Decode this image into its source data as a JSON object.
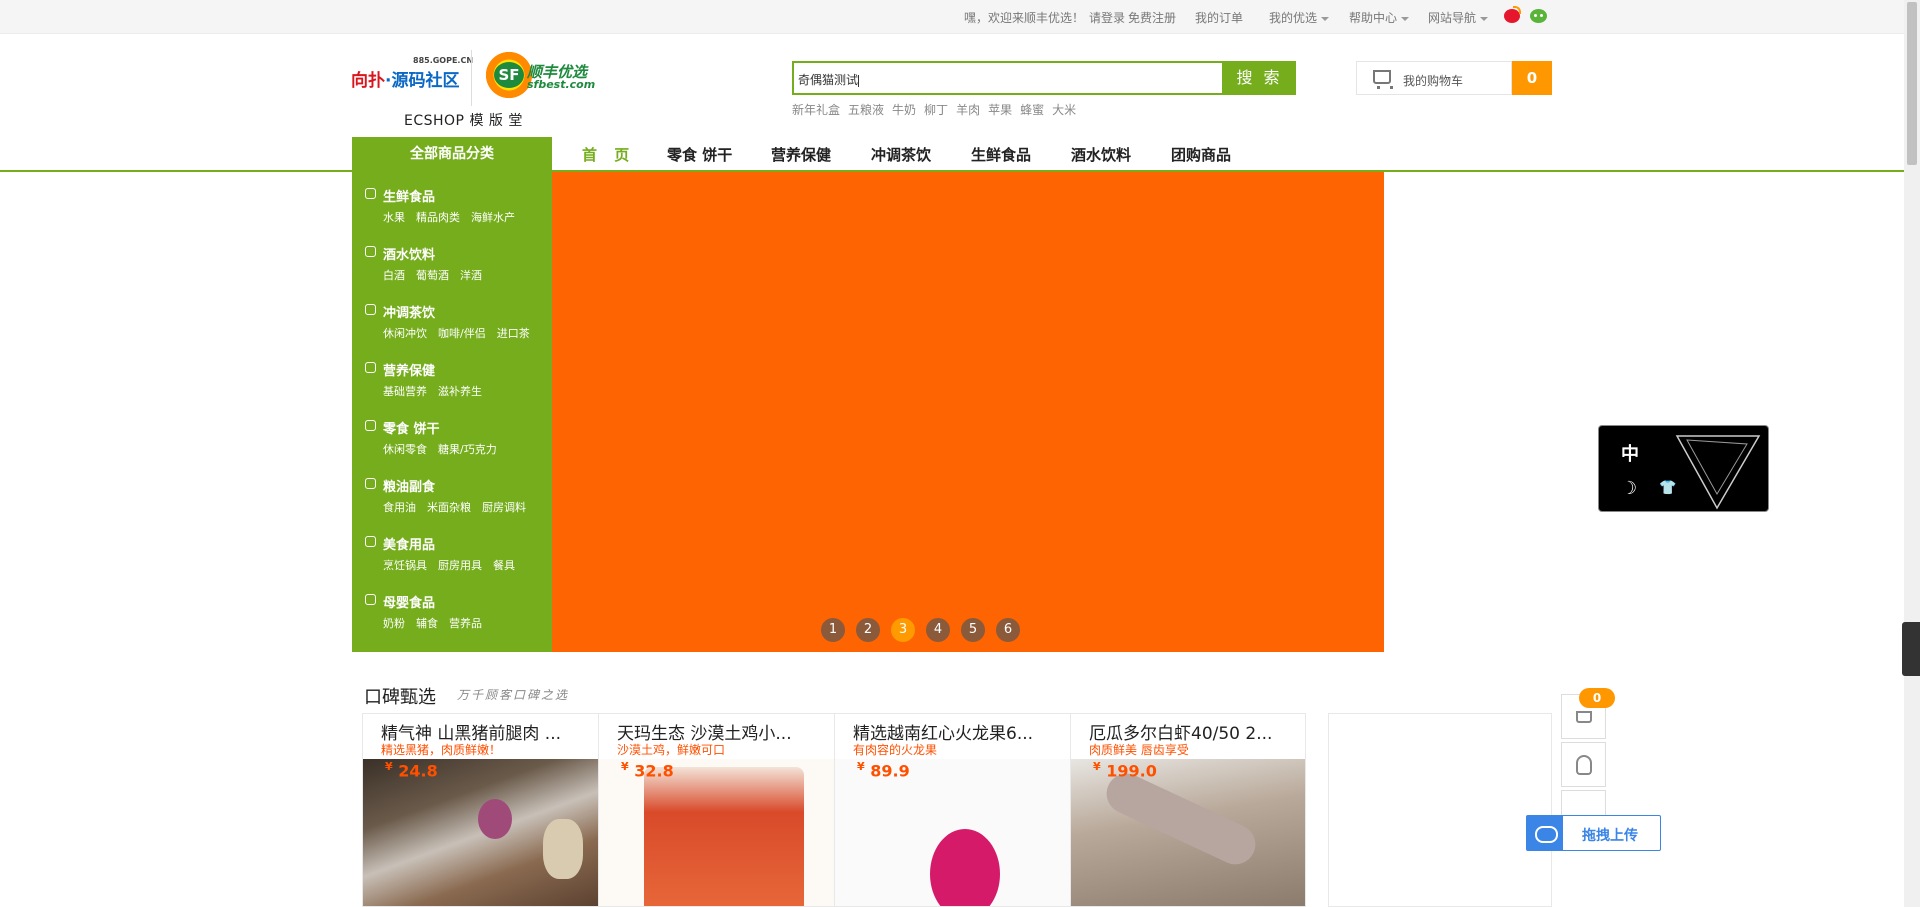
{
  "topbar": {
    "welcome": "嘿，欢迎来顺丰优选！",
    "login": "请登录",
    "register": "免费注册",
    "my_orders": "我的订单",
    "my_sf": "我的优选",
    "help": "帮助中心",
    "site_nav": "网站导航"
  },
  "logo": {
    "left_red": "向扑",
    "left_blue": "·源码社区",
    "site": "885.GOPE.CN",
    "sf_mark": "SF",
    "sf_name": "顺丰优选",
    "sf_url": "sfbest.com",
    "tagline": "ECSHOP 模 版 堂"
  },
  "search": {
    "value": "奇偶猫测试",
    "button": "搜 索",
    "hot_words": [
      "新年礼盒",
      "五粮液",
      "牛奶",
      "柳丁",
      "羊肉",
      "苹果",
      "蜂蜜",
      "大米"
    ]
  },
  "cart": {
    "label": "我的购物车",
    "count": "0"
  },
  "nav": {
    "all_categories": "全部商品分类",
    "items": [
      "首 页",
      "零食 饼干",
      "营养保健",
      "冲调茶饮",
      "生鲜食品",
      "酒水饮料",
      "团购商品"
    ]
  },
  "categories": [
    {
      "title": "生鲜食品",
      "subs": [
        "水果",
        "精品肉类",
        "海鲜水产"
      ]
    },
    {
      "title": "酒水饮料",
      "subs": [
        "白酒",
        "葡萄酒",
        "洋酒"
      ]
    },
    {
      "title": "冲调茶饮",
      "subs": [
        "休闲冲饮",
        "咖啡/伴侣",
        "进口茶"
      ]
    },
    {
      "title": "营养保健",
      "subs": [
        "基础营养",
        "滋补养生"
      ]
    },
    {
      "title": "零食 饼干",
      "subs": [
        "休闲零食",
        "糖果/巧克力"
      ]
    },
    {
      "title": "粮油副食",
      "subs": [
        "食用油",
        "米面杂粮",
        "厨房调料"
      ]
    },
    {
      "title": "美食用品",
      "subs": [
        "烹饪锅具",
        "厨房用具",
        "餐具"
      ]
    },
    {
      "title": "母婴食品",
      "subs": [
        "奶粉",
        "辅食",
        "营养品"
      ]
    }
  ],
  "banner": {
    "color": "#ff6402",
    "pages": [
      "1",
      "2",
      "3",
      "4",
      "5",
      "6"
    ],
    "active_page": "3"
  },
  "float_widget": {
    "zh": "中"
  },
  "section": {
    "title": "口碑甄选",
    "subtitle": "万千顾客口碑之选"
  },
  "products": [
    {
      "name": "精气神 山黑猪前腿肉 ...",
      "desc": "精选黑猪，肉质鲜嫩！",
      "currency": "¥",
      "price": "24.8",
      "image": "pork-photo"
    },
    {
      "name": "天玛生态 沙漠土鸡小...",
      "desc": "沙漠土鸡，鲜嫩可口",
      "currency": "¥",
      "price": "32.8",
      "image": "chicken-package"
    },
    {
      "name": "精选越南红心火龙果6...",
      "desc": "有肉容的火龙果",
      "currency": "¥",
      "price": "89.9",
      "image": "dragonfruit-photo"
    },
    {
      "name": "厄瓜多尔白虾40/50 2...",
      "desc": "肉质鲜美 唇齿享受",
      "currency": "¥",
      "price": "199.0",
      "image": "shrimp-photo"
    }
  ],
  "side_tools": {
    "cart_badge": "0"
  },
  "upload": {
    "label": "拖拽上传"
  },
  "colors": {
    "accent_green": "#75ad1d",
    "orange": "#ff9800",
    "price_red": "#ff5000",
    "upload_blue": "#3a85e6"
  }
}
